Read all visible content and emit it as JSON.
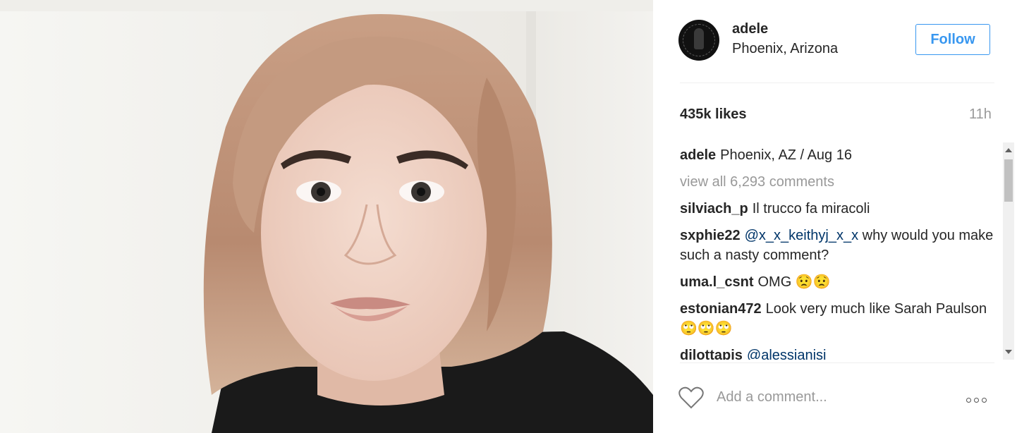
{
  "post": {
    "username": "adele",
    "location": "Phoenix, Arizona",
    "follow_label": "Follow",
    "likes": "435k likes",
    "time": "11h"
  },
  "caption": {
    "user": "adele",
    "text": "Phoenix, AZ / Aug 16"
  },
  "view_all": "view all 6,293 comments",
  "comments": [
    {
      "user": "silviach_p",
      "mention": "",
      "text": "Il trucco fa miracoli"
    },
    {
      "user": "sxphie22",
      "mention": "@x_x_keithyj_x_x",
      "text": "why would you make such a nasty comment?"
    },
    {
      "user": "uma.l_csnt",
      "mention": "",
      "text": "OMG 😟😟"
    },
    {
      "user": "estonian472",
      "mention": "",
      "text": "Look very much like Sarah Paulson🙄🙄🙄"
    },
    {
      "user": "dilottapis",
      "mention": "@alessianisi",
      "text": ""
    }
  ],
  "add_comment": {
    "placeholder": "Add a comment..."
  },
  "icons": {
    "like": "heart-icon",
    "more": "more-options-icon"
  },
  "colors": {
    "accent": "#3897f0",
    "muted": "#999999",
    "mention": "#003569"
  }
}
